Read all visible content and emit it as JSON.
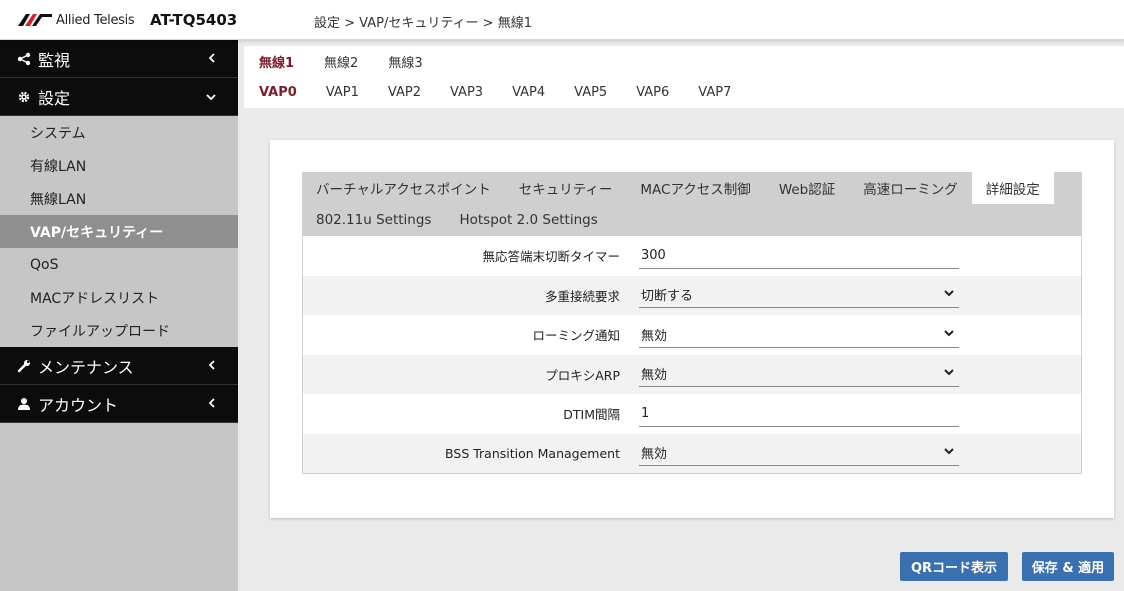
{
  "header": {
    "brand": "Allied Telesis",
    "model": "AT-TQ5403",
    "breadcrumb": "設定 > VAP/セキュリティー > 無線1"
  },
  "sidebar": {
    "sections": [
      {
        "label": "監視",
        "icon": "share-icon"
      },
      {
        "label": "設定",
        "icon": "gear-icon"
      },
      {
        "label": "メンテナンス",
        "icon": "wrench-icon"
      },
      {
        "label": "アカウント",
        "icon": "user-icon"
      }
    ],
    "settings_items": [
      "システム",
      "有線LAN",
      "無線LAN",
      "VAP/セキュリティー",
      "QoS",
      "MACアドレスリスト",
      "ファイルアップロード"
    ],
    "active_item": "VAP/セキュリティー"
  },
  "radio_tabs": [
    "無線1",
    "無線2",
    "無線3"
  ],
  "vap_tabs": [
    "VAP0",
    "VAP1",
    "VAP2",
    "VAP3",
    "VAP4",
    "VAP5",
    "VAP6",
    "VAP7"
  ],
  "settings_tabs": {
    "row1": [
      "バーチャルアクセスポイント",
      "セキュリティー",
      "MACアクセス制御",
      "Web認証",
      "高速ローミング",
      "詳細設定"
    ],
    "row2": [
      "802.11u Settings",
      "Hotspot 2.0 Settings"
    ],
    "active": "詳細設定"
  },
  "form": {
    "rows": [
      {
        "label": "無応答端末切断タイマー",
        "value": "300",
        "type": "input"
      },
      {
        "label": "多重接続要求",
        "value": "切断する",
        "type": "select"
      },
      {
        "label": "ローミング通知",
        "value": "無効",
        "type": "select"
      },
      {
        "label": "プロキシARP",
        "value": "無効",
        "type": "select"
      },
      {
        "label": "DTIM間隔",
        "value": "1",
        "type": "input"
      },
      {
        "label": "BSS Transition Management",
        "value": "無効",
        "type": "select"
      }
    ]
  },
  "buttons": {
    "qr": "QRコード表示",
    "save": "保存 & 適用"
  },
  "colors": {
    "accent_tab": "#7b1e2e",
    "button": "#3a6fb0",
    "sidebar_dark": "#0c0c0c"
  }
}
